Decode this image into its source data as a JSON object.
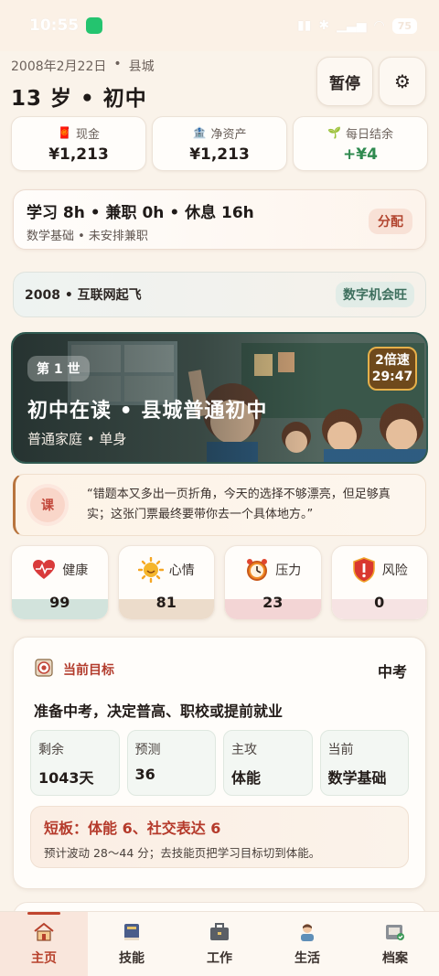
{
  "status_bar": {
    "time": "10:55",
    "battery": "75"
  },
  "header": {
    "date": "2008年2月22日",
    "location": "县城",
    "separator": "•",
    "age_stage": "13 岁 • 初中",
    "pause_label": "暂停"
  },
  "stats": [
    {
      "label": "现金",
      "value": "¥1,213",
      "icon": "red-envelope-icon"
    },
    {
      "label": "净资产",
      "value": "¥1,213",
      "icon": "bank-icon"
    },
    {
      "label": "每日结余",
      "value": "+¥4",
      "icon": "sprout-icon"
    }
  ],
  "schedule": {
    "main": "学习 8h • 兼职 0h • 休息 16h",
    "sub": "数学基础 • 未安排兼职",
    "assign_label": "分配"
  },
  "era": {
    "text": "2008 • 互联网起飞",
    "badge": "数字机会旺"
  },
  "hero": {
    "life_badge": "第 1 世",
    "speed_line1": "2倍速",
    "speed_line2": "29:47",
    "title": "初中在读 • 县城普通初中",
    "subtitle": "普通家庭 • 单身"
  },
  "quote": {
    "icon_label": "课",
    "text": "“错题本又多出一页折角，今天的选择不够漂亮，但足够真实；这张门票最终要带你去一个具体地方。”"
  },
  "vitals": [
    {
      "label": "健康",
      "value": "99",
      "icon": "heart-icon",
      "fill_color": "#d2e3dc"
    },
    {
      "label": "心情",
      "value": "81",
      "icon": "sun-icon",
      "fill_color": "#ecdccb"
    },
    {
      "label": "压力",
      "value": "23",
      "icon": "alarm-clock-icon",
      "fill_color": "#f3d5d5"
    },
    {
      "label": "风险",
      "value": "0",
      "icon": "warning-shield-icon",
      "fill_color": "#f6e3e3"
    }
  ],
  "goal": {
    "head_label": "当前目标",
    "tag": "中考",
    "description": "准备中考，决定普高、职校或提前就业",
    "cells": [
      {
        "label": "剩余",
        "value": "1043天"
      },
      {
        "label": "预测",
        "value": "36"
      },
      {
        "label": "主攻",
        "value": "体能"
      },
      {
        "label": "当前",
        "value": "数学基础"
      }
    ],
    "weak_title": "短板：体能 6、社交表达 6",
    "weak_sub": "预计波动 28～44 分；去技能页把学习目标切到体能。"
  },
  "nav": [
    {
      "label": "主页",
      "icon": "home-icon",
      "active": true
    },
    {
      "label": "技能",
      "icon": "book-icon",
      "active": false
    },
    {
      "label": "工作",
      "icon": "briefcase-icon",
      "active": false
    },
    {
      "label": "生活",
      "icon": "person-icon",
      "active": false
    },
    {
      "label": "档案",
      "icon": "archive-icon",
      "active": false
    }
  ],
  "colors": {
    "accent_red": "#b7412c",
    "positive_green": "#2f8a4f",
    "background": "#faf3ea"
  }
}
